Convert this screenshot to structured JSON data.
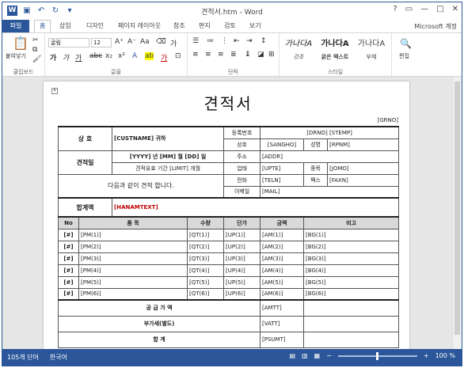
{
  "window": {
    "title": "견적서.htm - Word",
    "help": "?",
    "restore": "▭",
    "min": "—",
    "max": "□",
    "close": "✕"
  },
  "tabs": {
    "file": "파일",
    "home": "홈",
    "insert": "삽입",
    "design": "디자인",
    "layout": "페이지 레이아웃",
    "refs": "참조",
    "mail": "편지",
    "review": "검토",
    "view": "보기",
    "account": "Microsoft 계정"
  },
  "ribbon": {
    "clipboard_label": "클립보드",
    "paste_label": "붙여넣기",
    "font_label": "글꼴",
    "font_name": "굴림",
    "font_size": "12",
    "para_label": "단락",
    "style_label": "스타일",
    "edit_label": "편집",
    "styles": [
      {
        "preview": "가나다A",
        "caption": "강조"
      },
      {
        "preview": "가나다A",
        "caption": "굵은 텍스트"
      },
      {
        "preview": "가나다A",
        "caption": "부제"
      }
    ]
  },
  "doc": {
    "title": "견적서",
    "grno": "[GRNO]",
    "customer_label": "상 호",
    "customer_value": "[CUSTNAME] 귀하",
    "date_label": "견적일",
    "date_value": "[YYYY] 년 [MM] 월 [DD] 일",
    "validity": "견적유효 기간 [LIMIT] 개월",
    "greeting": "다음과 같이 견적 합니다.",
    "supplier": {
      "regno_label": "등록번호",
      "regno_value": "[DRNO] [STEMP]",
      "name_label": "상호",
      "name_value": "[SANGHO]",
      "rep_label": "성명",
      "rep_value": "[RPNM]",
      "addr_label": "주소",
      "addr_value": "[ADDR]",
      "biz_label": "업태",
      "biz_value": "[UPTE]",
      "item_label": "종목",
      "item_value": "[JOMO]",
      "tel_label": "전화",
      "tel_value": "[TELN]",
      "fax_label": "팩스",
      "fax_value": "[FAXN]",
      "mail_label": "이메일",
      "mail_value": "[MAIL]"
    },
    "total_label": "합계액",
    "total_value": "[HANAMTEXT]",
    "columns": [
      "No",
      "품 목",
      "수량",
      "단가",
      "금액",
      "비고"
    ],
    "rows": [
      [
        "[#]",
        "[PM(1)]",
        "[QT(1)]",
        "[UP(1)]",
        "[AM(1)]",
        "[BG(1)]"
      ],
      [
        "[#]",
        "[PM(2)]",
        "[QT(2)]",
        "[UP(2)]",
        "[AM(2)]",
        "[BG(2)]"
      ],
      [
        "[#]",
        "[PM(3)]",
        "[QT(3)]",
        "[UP(3)]",
        "[AM(3)]",
        "[BG(3)]"
      ],
      [
        "[#]",
        "[PM(4)]",
        "[QT(4)]",
        "[UP(4)]",
        "[AM(4)]",
        "[BG(4)]"
      ],
      [
        "[#]",
        "[PM(5)]",
        "[QT(5)]",
        "[UP(5)]",
        "[AM(5)]",
        "[BG(5)]"
      ],
      [
        "[#]",
        "[PM(6)]",
        "[QT(6)]",
        "[UP(6)]",
        "[AM(6)]",
        "[BG(6)]"
      ]
    ],
    "supply_label": "공 급 가 액",
    "supply_value": "[AMTT]",
    "vat_label": "부가세(별도)",
    "vat_value": "[VATT]",
    "sum_label": "합 계",
    "sum_value": "[PSUMT]"
  },
  "status": {
    "words": "105개 단어",
    "lang": "한국어",
    "zoom": "100 %",
    "zoom_percent": 100
  },
  "colors": {
    "accent": "#2b579a",
    "total_text": "#c00000"
  }
}
